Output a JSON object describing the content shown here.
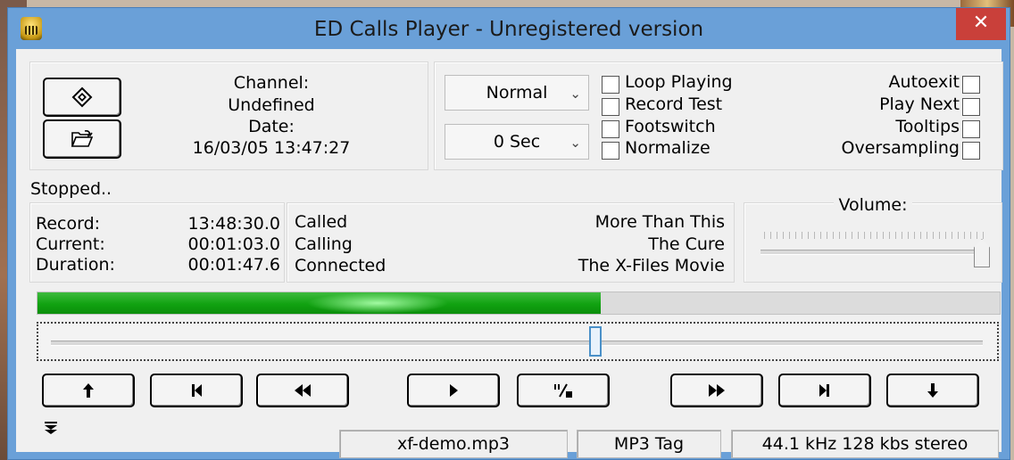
{
  "window": {
    "title": "ED Calls Player - Unregistered version",
    "close_glyph": "✕"
  },
  "info": {
    "channel_label": "Channel:",
    "channel_value": "Undefined",
    "date_label": "Date:",
    "date_value": "16/03/05 13:47:27"
  },
  "options": {
    "mode_select": "Normal",
    "delay_select": "0 Sec",
    "left_checks": [
      {
        "label": "Loop Playing",
        "checked": false
      },
      {
        "label": "Record Test",
        "checked": false
      },
      {
        "label": "Footswitch",
        "checked": false
      },
      {
        "label": "Normalize",
        "checked": false
      }
    ],
    "right_checks": [
      {
        "label": "Autoexit",
        "checked": false
      },
      {
        "label": "Play Next",
        "checked": false
      },
      {
        "label": "Tooltips",
        "checked": false
      },
      {
        "label": "Oversampling",
        "checked": false
      }
    ]
  },
  "status": {
    "text": "Stopped.."
  },
  "times": {
    "record_label": "Record:",
    "record_value": "13:48:30.0",
    "current_label": "Current:",
    "current_value": "00:01:03.0",
    "duration_label": "Duration:",
    "duration_value": "00:01:47.6"
  },
  "parties": {
    "called_label": "Called",
    "called_value": "More Than This",
    "calling_label": "Calling",
    "calling_value": "The Cure",
    "connected_label": "Connected",
    "connected_value": "The X-Files Movie"
  },
  "volume": {
    "label": "Volume:",
    "level": 0.98
  },
  "progress": {
    "fraction": 0.585
  },
  "seek": {
    "fraction": 0.584
  },
  "transport": {
    "prev_record_glyph": "🡑",
    "skip_start_glyph": "⏮",
    "rewind_glyph": "⏪",
    "play_glyph": "▶",
    "pause_stop_glyph": "ᐦ▪",
    "fast_forward_glyph": "⏩",
    "skip_end_glyph": "⏭",
    "next_record_glyph": "🡓"
  },
  "statusbar": {
    "file": "xf-demo.mp3",
    "tag": "MP3 Tag",
    "format": "44.1 kHz 128 kbs stereo"
  },
  "icons": {
    "app": "telephone-recorder-icon",
    "goto": "diamond-target-icon",
    "open": "open-folder-icon",
    "expand": "expand-down-icon"
  },
  "colors": {
    "progress": "#11a211",
    "titlebar": "#6aa0d8",
    "close": "#c9403a"
  }
}
